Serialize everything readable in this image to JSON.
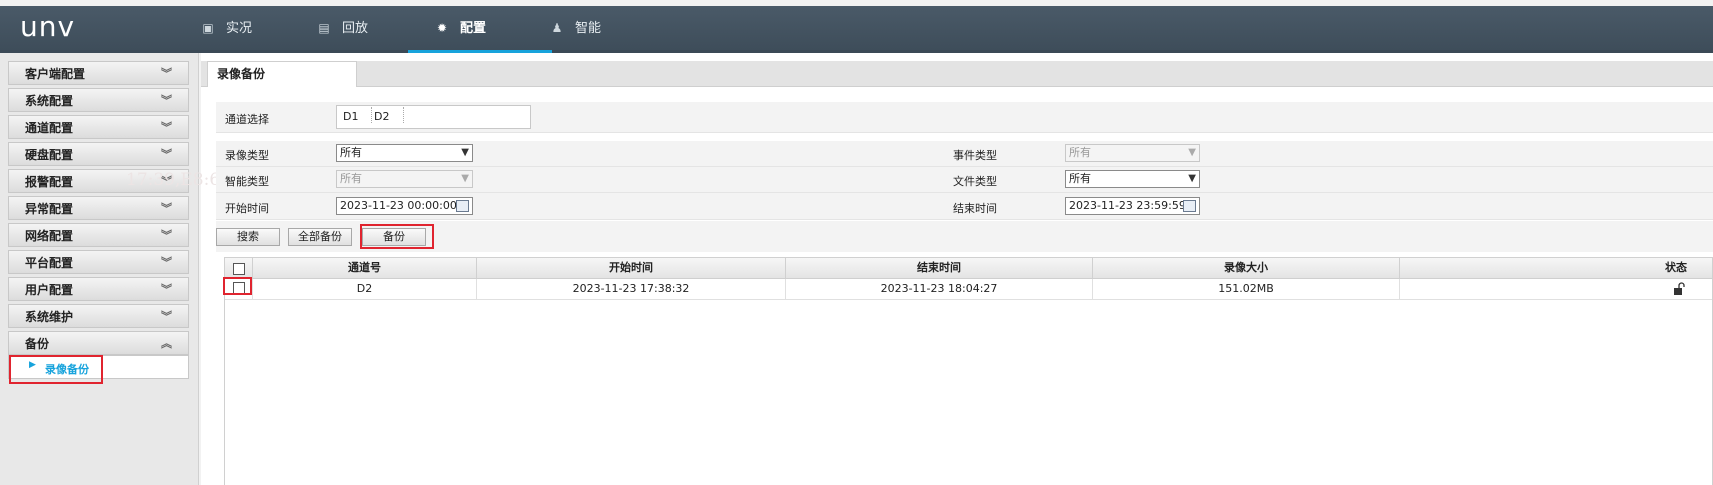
{
  "header": {
    "logo": "unv",
    "tabs": [
      {
        "label": "实况",
        "icon": "monitor-icon"
      },
      {
        "label": "回放",
        "icon": "film-icon"
      },
      {
        "label": "配置",
        "icon": "gear-icon"
      },
      {
        "label": "智能",
        "icon": "person-gear-icon"
      }
    ],
    "active_tab": "配置",
    "accent_color": "#17a3dc"
  },
  "sidebar": {
    "items": [
      {
        "label": "客户端配置"
      },
      {
        "label": "系统配置"
      },
      {
        "label": "通道配置"
      },
      {
        "label": "硬盘配置"
      },
      {
        "label": "报警配置"
      },
      {
        "label": "异常配置"
      },
      {
        "label": "网络配置"
      },
      {
        "label": "平台配置"
      },
      {
        "label": "用户配置"
      },
      {
        "label": "系统维护"
      },
      {
        "label": "备份"
      }
    ],
    "expanded_item": "备份",
    "sub_item": "录像备份"
  },
  "content": {
    "tab_label": "录像备份",
    "channel_label": "通道选择",
    "channels": [
      "D1",
      "D2"
    ],
    "record_type_label": "录像类型",
    "record_type_value": "所有",
    "smart_type_label": "智能类型",
    "smart_type_value": "所有",
    "start_time_label": "开始时间",
    "start_time_value": "2023-11-23 00:00:00",
    "event_type_label": "事件类型",
    "event_type_value": "所有",
    "file_type_label": "文件类型",
    "file_type_value": "所有",
    "end_time_label": "结束时间",
    "end_time_value": "2023-11-23 23:59:59",
    "buttons": {
      "search": "搜索",
      "backup_all": "全部备份",
      "backup": "备份"
    },
    "table": {
      "columns": [
        "通道号",
        "开始时间",
        "结束时间",
        "录像大小",
        "状态"
      ],
      "rows": [
        {
          "channel": "D2",
          "start": "2023-11-23 17:38:32",
          "end": "2023-11-23 18:04:27",
          "size": "151.02MB",
          "status": "unlock-icon"
        }
      ]
    },
    "watermark": "17:39,E8:6A:64:FC:76:83,y059"
  }
}
